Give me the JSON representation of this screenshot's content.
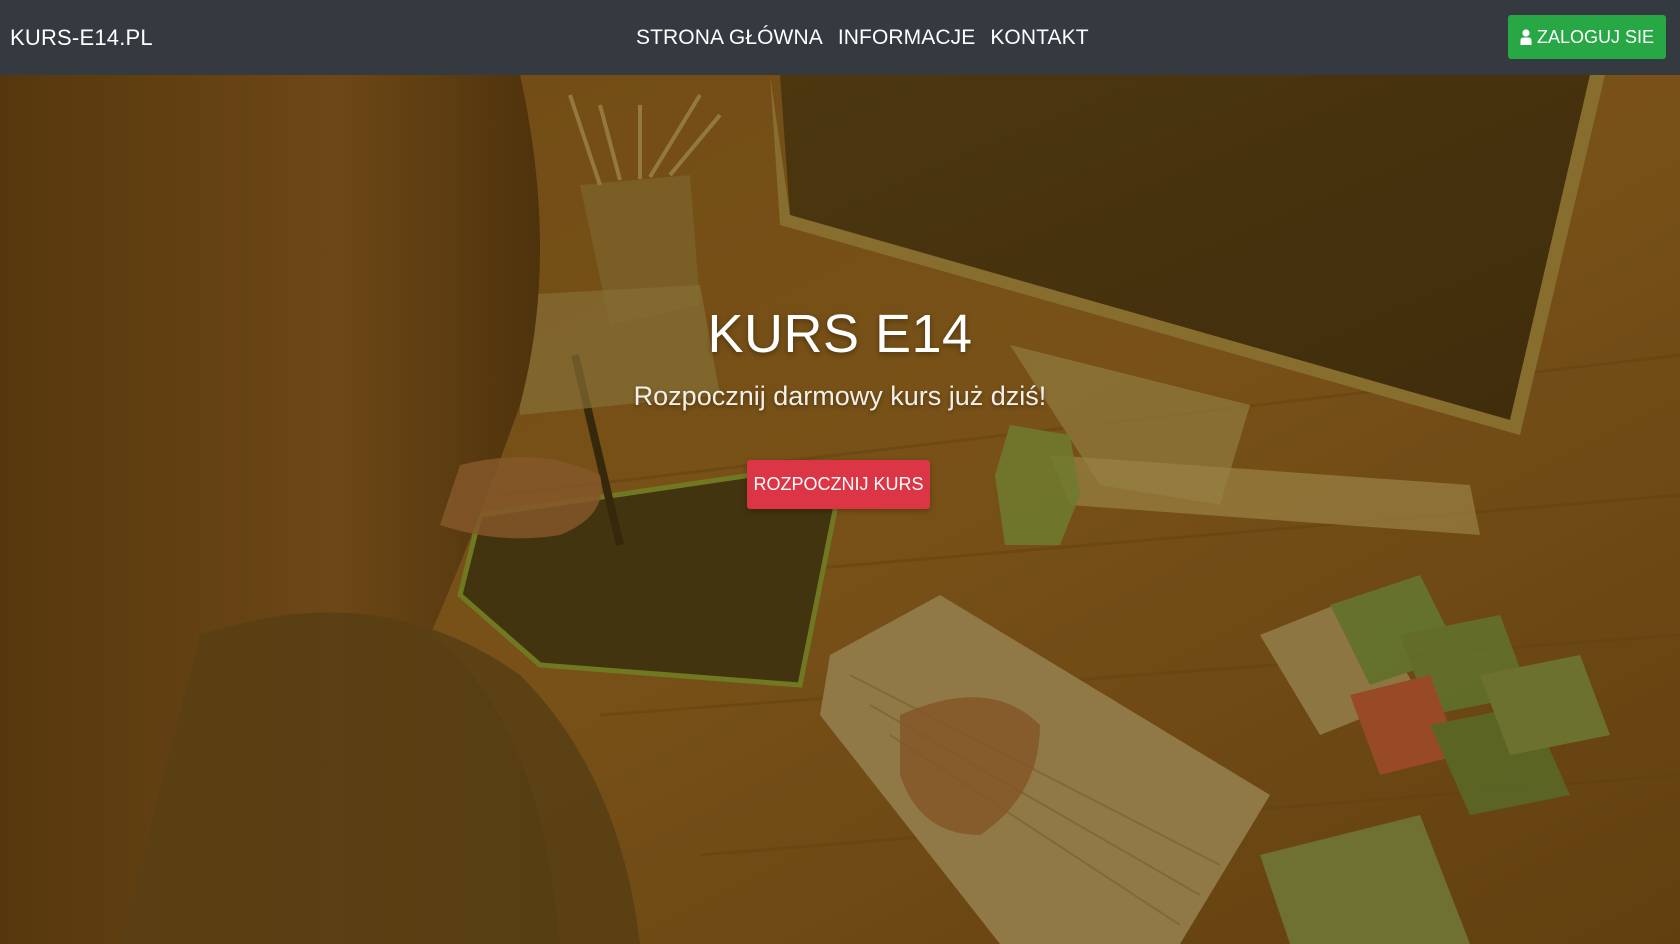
{
  "navbar": {
    "brand": "KURS-E14.PL",
    "links": [
      "STRONA GŁÓWNA",
      "INFORMACJE",
      "KONTAKT"
    ],
    "login_label": "ZALOGUJ SIE",
    "login_icon": "user-icon"
  },
  "hero": {
    "title": "KURS E14",
    "subtitle": "Rozpocznij darmowy kurs już dziś!",
    "cta_label": "ROZPOCZNIJ KURS",
    "background": "desk-workspace-photo"
  },
  "colors": {
    "navbar_bg": "#343a40",
    "login_button": "#28a745",
    "cta_button": "#dc3545",
    "overlay": "#785000"
  }
}
